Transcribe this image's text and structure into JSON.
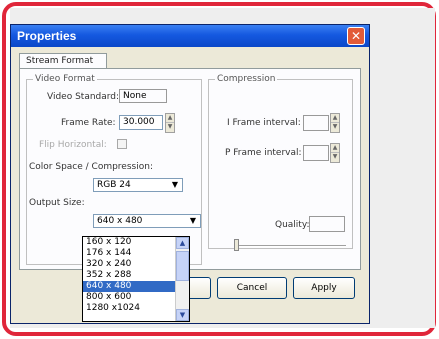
{
  "dialog": {
    "title": "Properties",
    "close_glyph": "✕",
    "tab_label": "Stream Format"
  },
  "video_format": {
    "group_label": "Video Format",
    "standard_label": "Video Standard:",
    "standard_value": "None",
    "frame_rate_label": "Frame Rate:",
    "frame_rate_value": "30.000",
    "flip_label": "Flip Horizontal:",
    "color_space_label": "Color Space / Compression:",
    "color_space_value": "RGB 24",
    "output_size_label": "Output Size:",
    "output_size_value": "640 x 480"
  },
  "compression": {
    "group_label": "Compression",
    "iframe_label": "I Frame interval:",
    "pframe_label": "P Frame interval:",
    "quality_label": "Quality:"
  },
  "buttons": {
    "cancel": "Cancel",
    "apply": "Apply"
  },
  "dropdown": {
    "options": [
      "160 x 120",
      "176 x 144",
      "320 x 240",
      "352 x 288",
      "640 x 480",
      "800 x 600",
      "1280 x1024"
    ],
    "selected_index": 4
  },
  "icons": {
    "close": "close-icon",
    "dropdown_arrow": "chevron-down-icon",
    "scroll_up": "chevron-up-icon",
    "scroll_down": "chevron-down-icon"
  },
  "colors": {
    "frame": "#e0263a",
    "titlebar": "#1559e0",
    "selection": "#316ac5",
    "close_button": "#e25b38"
  }
}
